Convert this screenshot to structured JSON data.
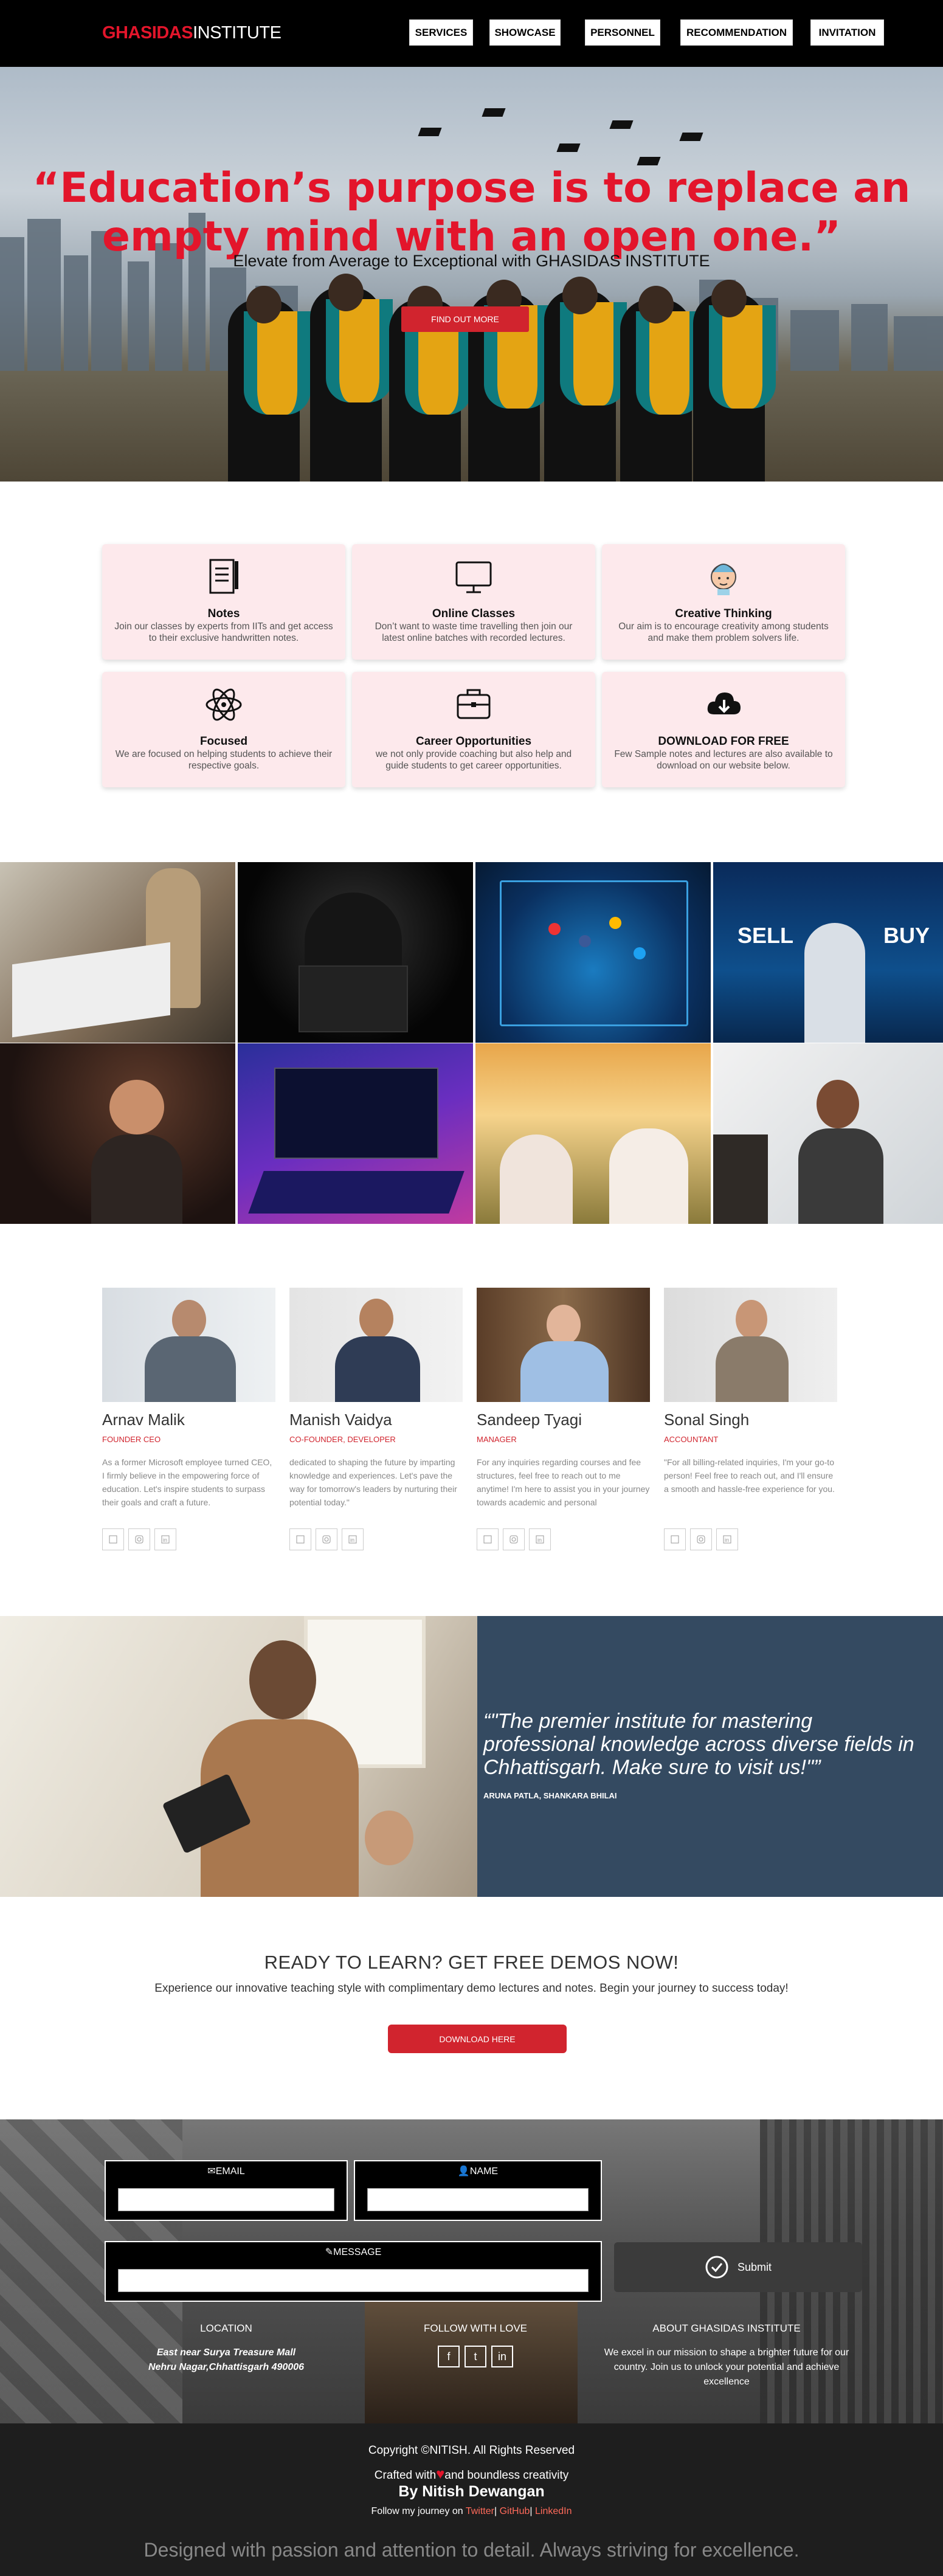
{
  "nav": {
    "logo_a": "GHASIDAS",
    "logo_b": "INSTITUTE",
    "items": [
      "SERVICES",
      "SHOWCASE",
      "PERSONNEL",
      "RECOMMENDATION",
      "INVITATION"
    ]
  },
  "hero": {
    "quote": "“Education’s purpose is to replace an empty mind with an open one.”",
    "subtitle": "Elevate from Average to Exceptional with GHASIDAS INSTITUTE",
    "cta": "FIND OUT MORE"
  },
  "features": [
    {
      "title": "Notes",
      "desc": "Join our classes by experts from IITs and get access to their exclusive handwritten notes.",
      "icon": "notes-icon"
    },
    {
      "title": "Online Classes",
      "desc": "Don’t want to waste time travelling then join our latest online batches with recorded lectures.",
      "icon": "monitor-icon"
    },
    {
      "title": "Creative Thinking",
      "desc": "Our aim is to encourage creativity among students and make them problem solvers life.",
      "icon": "thinking-head-icon"
    },
    {
      "title": "Focused",
      "desc": "We are focused on helping students to achieve their respective goals.",
      "icon": "atom-icon"
    },
    {
      "title": "Career Opportunities",
      "desc": "we not only provide coaching but also help and guide students to get career opportunities.",
      "icon": "briefcase-icon"
    },
    {
      "title": "DOWNLOAD FOR FREE",
      "desc": "Few Sample notes and lectures are also available to download on our website below.",
      "icon": "cloud-download-icon"
    }
  ],
  "gallery": [
    "fashion-design",
    "hacker",
    "social-media",
    "stock-trading",
    "concert",
    "coding",
    "yoga",
    "business-meeting"
  ],
  "team": [
    {
      "name": "Arnav Malik",
      "role": "FOUNDER CEO",
      "bio": "As a former Microsoft employee turned CEO, I firmly believe in the empowering force of education. Let's inspire students to surpass their goals and craft a future."
    },
    {
      "name": "Manish Vaidya",
      "role": "CO-FOUNDER, DEVELOPER",
      "bio": "dedicated to shaping the future by imparting knowledge and experiences. Let's pave the way for tomorrow's leaders by nurturing their potential today.\""
    },
    {
      "name": "Sandeep Tyagi",
      "role": "MANAGER",
      "bio": "For any inquiries regarding courses and fee structures, feel free to reach out to me anytime! I'm here to assist you in your journey towards academic and personal"
    },
    {
      "name": "Sonal Singh",
      "role": "ACCOUNTANT",
      "bio": "\"For all billing-related inquiries, I'm your go-to person! Feel free to reach out, and I'll ensure a smooth and hassle-free experience for you."
    }
  ],
  "testimonial": {
    "quote": "“\"The premier institute for mastering professional knowledge across diverse fields in Chhattisgarh. Make sure to visit us!\"”",
    "author": "ARUNA PATLA, SHANKARA BHILAI"
  },
  "ready": {
    "title": "READY TO LEARN? GET FREE DEMOS NOW!",
    "desc": "Experience our innovative teaching style with complimentary demo lectures and notes. Begin your journey to success today!",
    "button": "DOWNLOAD HERE"
  },
  "contact": {
    "email_label": "EMAIL",
    "name_label": "NAME",
    "message_label": "MESSAGE",
    "submit": "Submit",
    "location_title": "LOCATION",
    "location_line1": "East near Surya Treasure Mall",
    "location_line2": "Nehru Nagar,Chhattisgarh 490006",
    "follow_title": "FOLLOW WITH LOVE",
    "about_title": "ABOUT GHASIDAS INSTITUTE",
    "about_text": "We excel in our mission to shape a brighter future for our country. Join us to unlock your potential and achieve excellence"
  },
  "footer": {
    "copyright": "Copyright ©NITISH. All Rights Reserved",
    "crafted_a": "Crafted with",
    "crafted_b": "and boundless creativity",
    "by": "By Nitish Dewangan",
    "follow_prefix": "Follow my journey on",
    "links": [
      "Twitter",
      "GitHub",
      "LinkedIn"
    ],
    "tagline": "Designed with passion and attention to detail. Always striving for excellence."
  },
  "colors": {
    "accent": "#e3152b",
    "button": "#d1242e",
    "card": "#fde9ec",
    "testimonial_bg": "#344a61"
  }
}
